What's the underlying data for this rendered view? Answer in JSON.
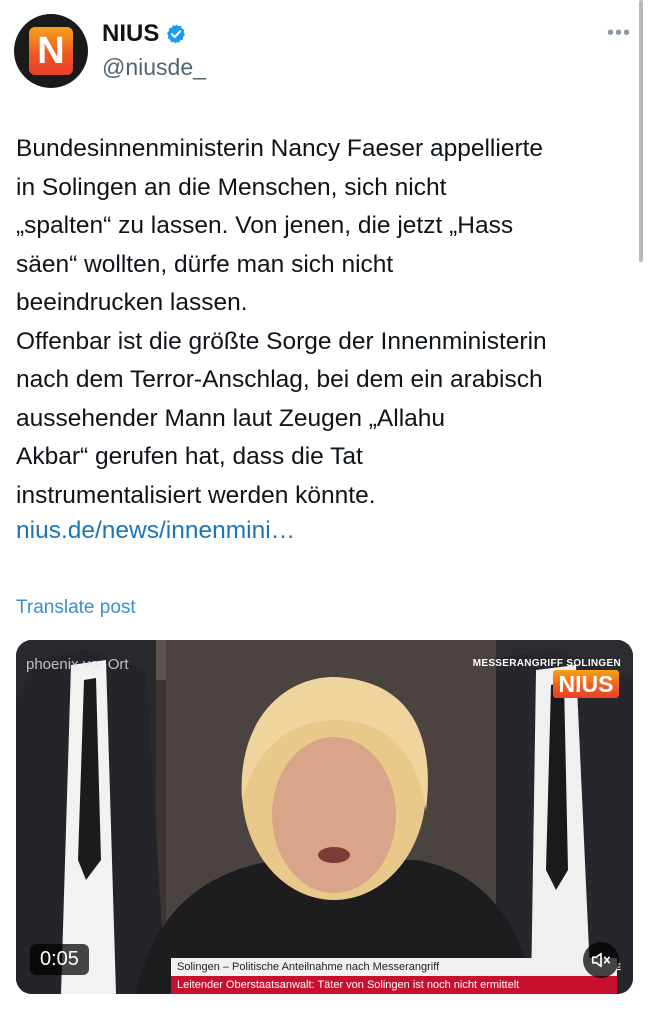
{
  "author": {
    "name": "NIUS",
    "handle": "@niusde_",
    "avatar_letter": "N",
    "verified": true
  },
  "menu": {
    "more_label": "•••"
  },
  "tweet": {
    "text": "Bundesinnenministerin Nancy Faeser appellierte\nin Solingen an die Menschen, sich nicht\n„spalten“ zu lassen. Von jenen, die jetzt „Hass\nsäen“ wollten, dürfe man sich nicht\nbeeindrucken lassen.\nOffenbar ist die größte Sorge der Innenministerin\nnach dem Terror-Anschlag, bei dem ein arabisch\naussehender Mann laut Zeugen „Allahu\nAkbar“ gerufen hat, dass die Tat\ninstrumentalisiert werden könnte.",
    "link": "nius.de/news/innenmini…",
    "translate_label": "Translate post"
  },
  "video": {
    "timestamp": "0:05",
    "channel_watermark": "phoenix vor Ort",
    "breaking_label": "MESSERANGRIFF SOLINGEN",
    "logo_text": "NIUS",
    "headline": "Solingen – Politische Anteilnahme nach Messerangriff",
    "ticker": "Leitender Oberstaatsanwalt: Täter von Solingen ist noch nicht ermittelt",
    "live_label": "LIVE"
  },
  "colors": {
    "link": "#1d75b8",
    "translate": "#3a8fd0",
    "verified": "#1d9bf0",
    "ticker": "#c8102e",
    "logo_orange": "#ef5a24"
  },
  "icons": [
    "verified-badge-icon",
    "more-icon",
    "mute-icon"
  ]
}
